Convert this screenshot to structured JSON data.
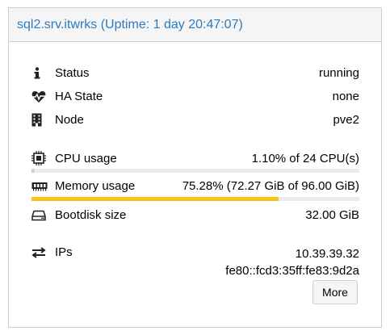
{
  "panel": {
    "title": "sql2.srv.itwrks (Uptime: 1 day 20:47:07)"
  },
  "status": {
    "label": "Status",
    "value": "running",
    "icon": "info-icon"
  },
  "ha_state": {
    "label": "HA State",
    "value": "none",
    "icon": "heartbeat-icon"
  },
  "node": {
    "label": "Node",
    "value": "pve2",
    "icon": "building-icon"
  },
  "cpu": {
    "label": "CPU usage",
    "value": "1.10% of 24 CPU(s)",
    "percent": 1.1,
    "icon": "cpu-chip-icon"
  },
  "memory": {
    "label": "Memory usage",
    "value": "75.28% (72.27 GiB of 96.00 GiB)",
    "percent": 75.28,
    "icon": "memory-icon",
    "bar_color": "#f5c518"
  },
  "bootdisk": {
    "label": "Bootdisk size",
    "value": "32.00 GiB",
    "icon": "hdd-icon"
  },
  "ips": {
    "label": "IPs",
    "icon": "exchange-arrows-icon",
    "addresses": [
      "10.39.39.32",
      "fe80::fcd3:35ff:fe83:9d2a"
    ],
    "more_label": "More"
  },
  "colors": {
    "title": "#2f7bbf",
    "header_bg": "#f5f5f5",
    "border": "#cfcfcf"
  }
}
